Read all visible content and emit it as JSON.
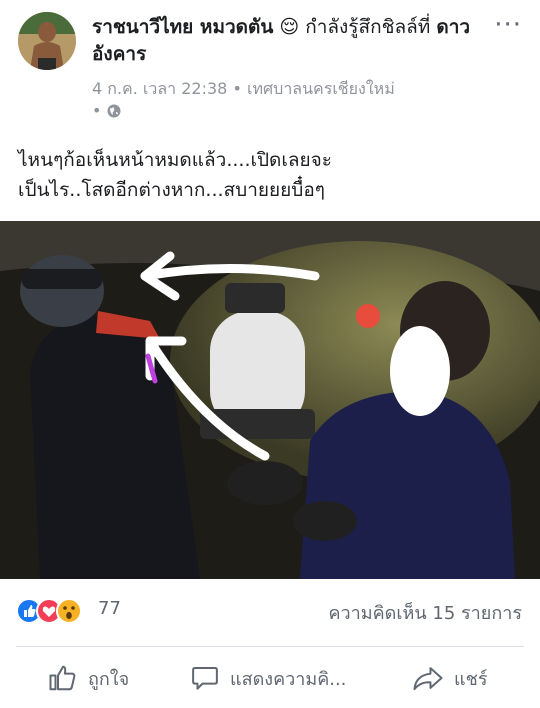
{
  "post": {
    "author": "ราชนาวีไทย หมวดตัน",
    "feeling_emoji": "😌",
    "feeling_text": "กำลังรู้สึกชิลล์ที่",
    "place": "ดาวอังคาร",
    "timestamp": "4 ก.ค. เวลา 22:38",
    "location": "เทศบาลนครเชียงใหม่",
    "separator": "•",
    "body_line1": "ไหนๆก้อเห็นหน้าหมดแล้ว....เปิดเลยจะ",
    "body_line2": "เป็นไร..โสดอีกต่างหาก...สบายยยบื๋อๆ"
  },
  "reactions": {
    "count": "77",
    "comments": "ความคิดเห็น 15 รายการ"
  },
  "actions": {
    "like": "ถูกใจ",
    "comment": "แสดงความคิ...",
    "share": "แชร์"
  },
  "menu": {
    "more": "···"
  },
  "icons": [
    "like-reaction-icon",
    "love-reaction-icon",
    "wow-reaction-icon",
    "globe-icon",
    "more-icon",
    "like-icon",
    "comment-icon",
    "share-icon"
  ],
  "colors": {
    "like_blue": "#1877f2",
    "love_red": "#f33e58",
    "wow_yellow": "#f7b125",
    "meta_gray": "#90949c"
  }
}
